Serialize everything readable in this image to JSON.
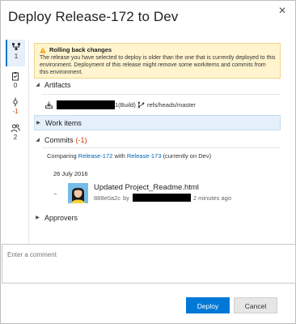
{
  "dialog": {
    "title": "Deploy Release-172 to Dev",
    "close_glyph": "✕"
  },
  "rail": {
    "items": [
      {
        "icon": "pipeline-icon",
        "count": "1"
      },
      {
        "icon": "work-item-icon",
        "count": "0"
      },
      {
        "icon": "commit-icon",
        "count": "-1"
      },
      {
        "icon": "people-icon",
        "count": "2"
      }
    ]
  },
  "warning": {
    "title": "Rolling back changes",
    "body": "The release you have selected to deploy is older than the one that is currently deployed to this environment. Deployment of this release might remove some workitems and commits from this environment."
  },
  "artifacts": {
    "label": "Artifacts",
    "row_build": "1(Build)",
    "row_branch": "refs/heads/master"
  },
  "work_items": {
    "label": "Work items"
  },
  "commits": {
    "label": "Commits",
    "count": "(-1)",
    "comparing_prefix": "Comparing",
    "from_release": "Release-172",
    "with_word": "with",
    "to_release": "Release-173",
    "suffix": "(currently on Dev)",
    "date": "26 July 2016",
    "items": [
      {
        "title": "Updated Project_Readme.html",
        "hash": "888e0a2c",
        "by": "by",
        "time": "2 minutes ago"
      }
    ]
  },
  "approvers": {
    "label": "Approvers"
  },
  "comment": {
    "placeholder": "Enter a comment"
  },
  "buttons": {
    "deploy": "Deploy",
    "cancel": "Cancel"
  },
  "colors": {
    "accent": "#0078d7",
    "warning_bg": "#fff4ce",
    "negative": "#d83b01"
  }
}
